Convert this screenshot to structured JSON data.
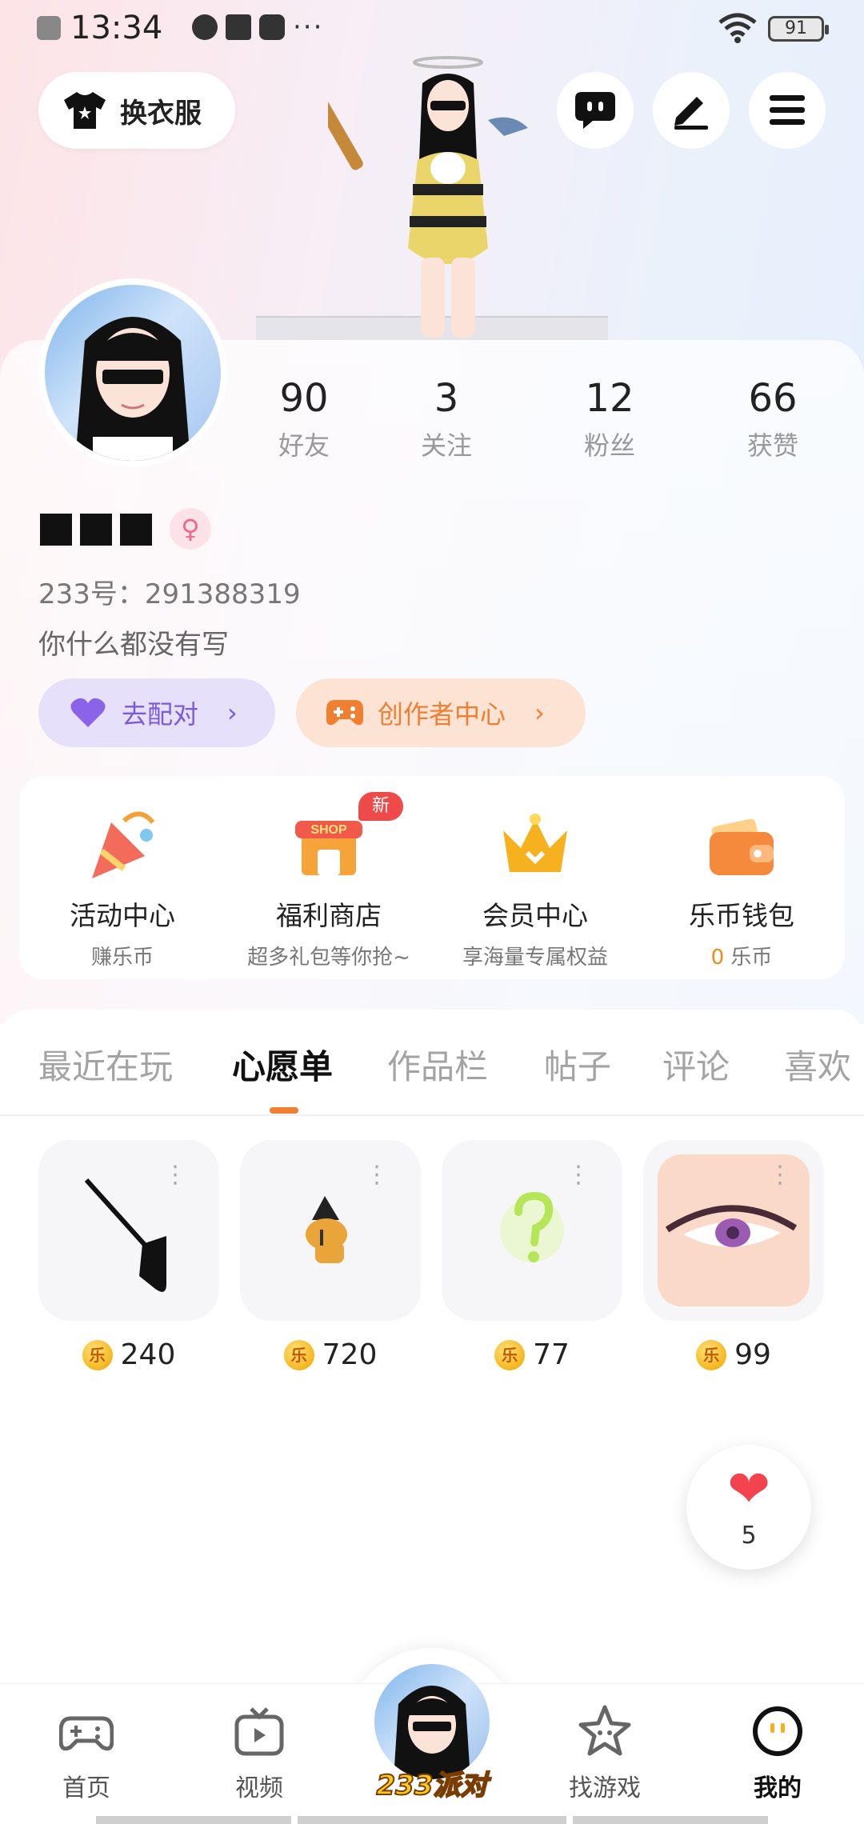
{
  "status_bar": {
    "time": "13:34",
    "battery": "91",
    "more": "···"
  },
  "top_actions": {
    "dress_label": "换衣服",
    "icons": [
      "chat-icon",
      "edit-icon",
      "menu-icon"
    ]
  },
  "profile": {
    "stats": [
      {
        "value": "90",
        "label": "好友"
      },
      {
        "value": "3",
        "label": "关注"
      },
      {
        "value": "12",
        "label": "粉丝"
      },
      {
        "value": "66",
        "label": "获赞"
      }
    ],
    "gender_symbol": "♀",
    "uid": "233号：291388319",
    "bio": "你什么都没有写",
    "match_label": "去配对",
    "creator_label": "创作者中心",
    "chevron": "›"
  },
  "features": [
    {
      "title": "活动中心",
      "subtitle": "赚乐币",
      "icon": "party-icon"
    },
    {
      "title": "福利商店",
      "subtitle": "超多礼包等你抢~",
      "icon": "shop-icon",
      "badge": "新"
    },
    {
      "title": "会员中心",
      "subtitle": "享海量专属权益",
      "icon": "crown-icon"
    },
    {
      "title": "乐币钱包",
      "subtitle_value": "0",
      "subtitle_unit": "乐币",
      "icon": "wallet-icon"
    }
  ],
  "shop_sign": "SHOP",
  "tabs": [
    "最近在玩",
    "心愿单",
    "作品栏",
    "帖子",
    "评论",
    "喜欢"
  ],
  "active_tab": "心愿单",
  "wishlist": [
    {
      "price": "240",
      "item": "bag-icon"
    },
    {
      "price": "720",
      "item": "tiger-icon"
    },
    {
      "price": "77",
      "item": "question-icon"
    },
    {
      "price": "99",
      "item": "eye-icon"
    }
  ],
  "wish_more": "⋮",
  "coin_glyph": "乐",
  "likes": {
    "count": "5"
  },
  "bottom_nav": [
    {
      "label": "首页",
      "icon": "gamepad-icon"
    },
    {
      "label": "视频",
      "icon": "tv-icon"
    },
    {
      "label": "233派对",
      "icon": "party-avatar"
    },
    {
      "label": "找游戏",
      "icon": "star-icon"
    },
    {
      "label": "我的",
      "icon": "me-icon"
    }
  ],
  "colors": {
    "accent": "#f07f31",
    "match": "#7b5ad8",
    "heart": "#f2434f"
  }
}
